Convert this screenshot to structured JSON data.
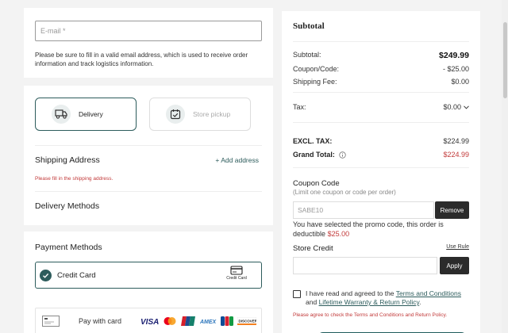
{
  "contact": {
    "email_placeholder": "E-mail *",
    "help_text": "Please be sure to fill in a valid email address, which is used to receive order information and track logistics information."
  },
  "delivery_options": [
    {
      "label": "Delivery",
      "icon": "truck-icon",
      "selected": true
    },
    {
      "label": "Store pickup",
      "icon": "calendar-check-icon",
      "selected": false
    }
  ],
  "shipping": {
    "title": "Shipping Address",
    "add_label": "+ Add address",
    "error": "Please fill in the shipping address."
  },
  "delivery_methods": {
    "title": "Delivery Methods"
  },
  "payment": {
    "title": "Payment Methods",
    "credit_card_label": "Credit Card",
    "credit_card_icon_text": "Credit Card",
    "pay_with_label": "Pay with card",
    "brands": [
      "VISA",
      "mastercard",
      "UnionPay",
      "AMEX",
      "JCB",
      "DISCOVER"
    ]
  },
  "summary": {
    "title": "Subtotal",
    "rows": [
      {
        "label": "Subtotal:",
        "value": "$249.99"
      },
      {
        "label": "Coupon/Code:",
        "value": "- $25.00"
      },
      {
        "label": "Shipping Fee:",
        "value": "$0.00"
      },
      {
        "label": "Tax:",
        "value": "$0.00"
      },
      {
        "label": "EXCL. TAX:",
        "value": "$224.99"
      },
      {
        "label": "Grand Total:",
        "value": "$224.99"
      }
    ]
  },
  "coupon": {
    "title": "Coupon Code",
    "subtitle": "(Limit one coupon or code per order)",
    "value": "SABE10",
    "remove_label": "Remove",
    "note_prefix": "You have selected the promo code, this order is deductible",
    "note_amount": "$25.00"
  },
  "store_credit": {
    "title": "Store Credit",
    "rule_label": "Use Rule",
    "apply_label": "Apply"
  },
  "agreement": {
    "prefix": "I have read and agreed to the",
    "terms_link": "Terms and Conditions",
    "and": "and",
    "warranty_link": "Lifetime Warranty & Return Policy",
    "suffix": ".",
    "error": "Please agree to check the Terms and Conditions and Return Policy."
  },
  "colors": {
    "accent": "#2d5c5c",
    "error": "#c23a3a"
  }
}
